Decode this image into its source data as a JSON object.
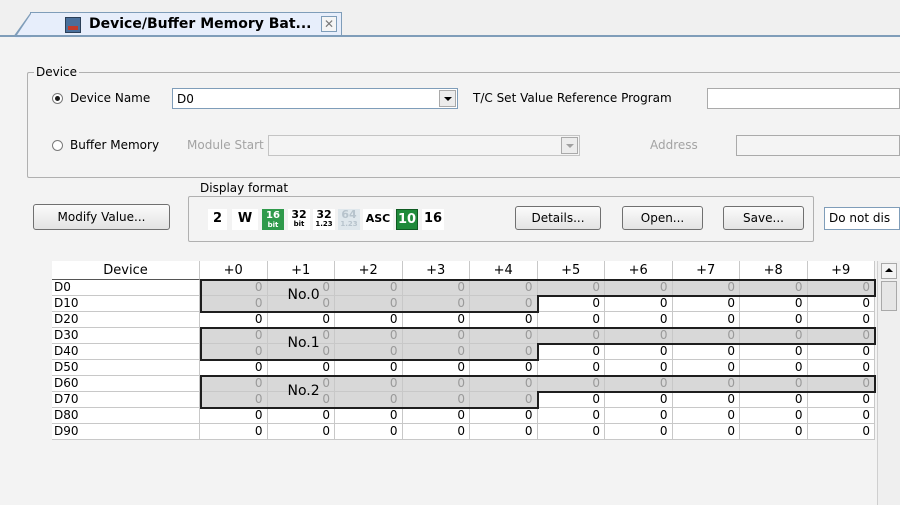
{
  "tab": {
    "title": "Device/Buffer Memory Bat...",
    "close": "✕"
  },
  "device_group": {
    "legend": "Device",
    "device_name_label": "Device Name",
    "device_name_value": "D0",
    "tc_label": "T/C Set Value Reference Program",
    "buffer_memory_label": "Buffer Memory",
    "module_start_label": "Module Start",
    "address_label": "Address"
  },
  "display_format": {
    "legend": "Display format",
    "buttons": [
      {
        "top": "2",
        "bottom": ""
      },
      {
        "top": "W",
        "bottom": ""
      },
      {
        "top": "16",
        "bottom": "bit"
      },
      {
        "top": "32",
        "bottom": "bit"
      },
      {
        "top": "32",
        "bottom": "1.23"
      },
      {
        "top": "64",
        "bottom": "1.23"
      },
      {
        "top": "ASC",
        "bottom": ""
      },
      {
        "top": "10",
        "bottom": ""
      },
      {
        "top": "16",
        "bottom": ""
      }
    ]
  },
  "buttons": {
    "modify": "Modify Value...",
    "details": "Details...",
    "open": "Open...",
    "save": "Save...",
    "do_not_display": "Do not dis"
  },
  "grid": {
    "columns": [
      "Device",
      "+0",
      "+1",
      "+2",
      "+3",
      "+4",
      "+5",
      "+6",
      "+7",
      "+8",
      "+9"
    ],
    "rows": [
      {
        "device": "D0",
        "values": [
          "0",
          "0",
          "0",
          "0",
          "0",
          "0",
          "0",
          "0",
          "0",
          "0"
        ]
      },
      {
        "device": "D10",
        "values": [
          "0",
          "0",
          "0",
          "0",
          "0",
          "0",
          "0",
          "0",
          "0",
          "0"
        ]
      },
      {
        "device": "D20",
        "values": [
          "0",
          "0",
          "0",
          "0",
          "0",
          "0",
          "0",
          "0",
          "0",
          "0"
        ]
      },
      {
        "device": "D30",
        "values": [
          "0",
          "0",
          "0",
          "0",
          "0",
          "0",
          "0",
          "0",
          "0",
          "0"
        ]
      },
      {
        "device": "D40",
        "values": [
          "0",
          "0",
          "0",
          "0",
          "0",
          "0",
          "0",
          "0",
          "0",
          "0"
        ]
      },
      {
        "device": "D50",
        "values": [
          "0",
          "0",
          "0",
          "0",
          "0",
          "0",
          "0",
          "0",
          "0",
          "0"
        ]
      },
      {
        "device": "D60",
        "values": [
          "0",
          "0",
          "0",
          "0",
          "0",
          "0",
          "0",
          "0",
          "0",
          "0"
        ]
      },
      {
        "device": "D70",
        "values": [
          "0",
          "0",
          "0",
          "0",
          "0",
          "0",
          "0",
          "0",
          "0",
          "0"
        ]
      },
      {
        "device": "D80",
        "values": [
          "0",
          "0",
          "0",
          "0",
          "0",
          "0",
          "0",
          "0",
          "0",
          "0"
        ]
      },
      {
        "device": "D90",
        "values": [
          "0",
          "0",
          "0",
          "0",
          "0",
          "0",
          "0",
          "0",
          "0",
          "0"
        ]
      }
    ],
    "blocks": [
      {
        "label": "No.0",
        "row": 0
      },
      {
        "label": "No.1",
        "row": 3
      },
      {
        "label": "No.2",
        "row": 6
      }
    ]
  }
}
